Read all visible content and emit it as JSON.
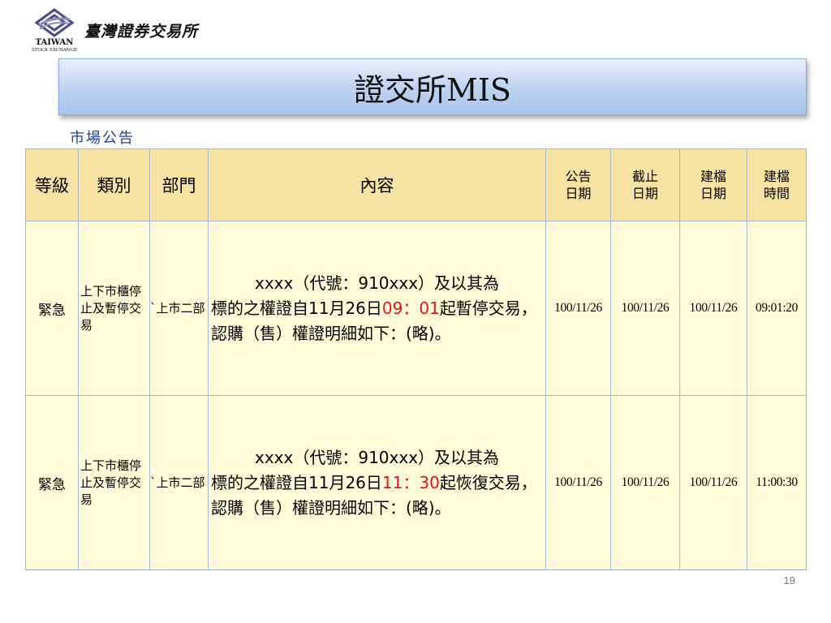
{
  "brand": {
    "logo_en": "TAIWAN",
    "logo_en_sub": "STOCK EXCHANGE",
    "name_cn": "臺灣證券交易所"
  },
  "title": "證交所MIS",
  "section_label": "市場公告",
  "table": {
    "headers": {
      "level": "等級",
      "category": "類別",
      "department": "部門",
      "content": "內容",
      "announce_l1": "公告",
      "announce_l2": "日期",
      "deadline_l1": "截止",
      "deadline_l2": "日期",
      "build_date_l1": "建檔",
      "build_date_l2": "日期",
      "build_time_l1": "建檔",
      "build_time_l2": "時間"
    },
    "rows": [
      {
        "level": "緊急",
        "category": "上下市櫃停止及暫停交易",
        "department": "`上市二部",
        "content_indent": "xxxx（代號：910xxx）及以其為",
        "content_pre": "標的之權證自11月26日",
        "content_time": "09：01",
        "content_post": "起暫停交易，認購（售）權證明細如下：(略)。",
        "announce_date": "100/11/26",
        "deadline_date": "100/11/26",
        "build_date": "100/11/26",
        "build_time": "09:01:20"
      },
      {
        "level": "緊急",
        "category": "上下市櫃停止及暫停交易",
        "department": "`上市二部",
        "content_indent": "xxxx（代號：910xxx）及以其為",
        "content_pre": "標的之權證自11月26日",
        "content_time": "11：30",
        "content_post": "起恢復交易，認購（售）權證明細如下：(略)。",
        "announce_date": "100/11/26",
        "deadline_date": "100/11/26",
        "build_date": "100/11/26",
        "build_time": "11:00:30"
      }
    ]
  },
  "page_number": "19",
  "colors": {
    "header_bg": "#f6e2a3",
    "cell_bg": "#fffbd9",
    "highlight_red": "#e0141e",
    "label_blue": "#1f3f99"
  }
}
